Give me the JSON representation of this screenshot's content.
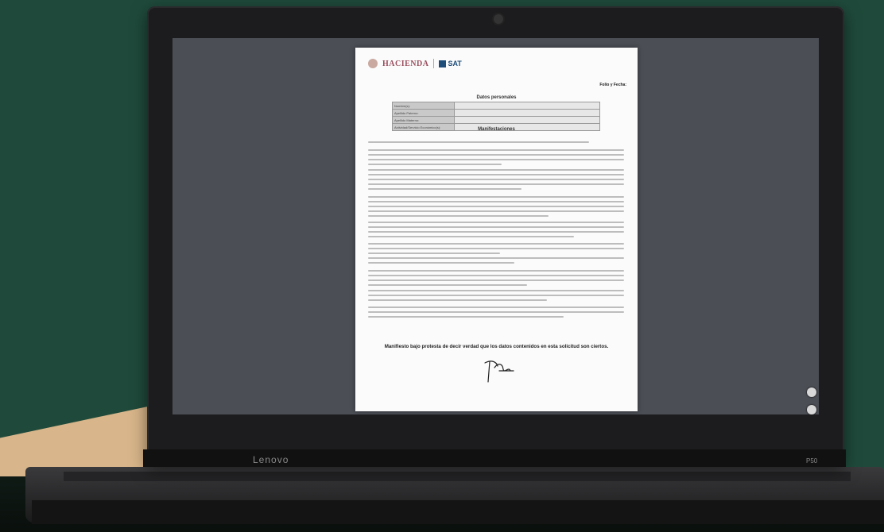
{
  "document": {
    "logo_hacienda": "HACIENDA",
    "logo_sat": "SAT",
    "folio_label": "Folio y Fecha:",
    "section_personal": "Datos personales",
    "table_rows": [
      {
        "k": "Nombre(s):",
        "v": ""
      },
      {
        "k": "Apellido Paterno:",
        "v": ""
      },
      {
        "k": "Apellido Materno:",
        "v": ""
      },
      {
        "k": "Actividad/Servicio Económico(s):",
        "v": ""
      }
    ],
    "section_manifest": "Manifestaciones",
    "declaration": "Manifiesto bajo protesta de decir verdad que los datos contenidos en esta solicitud son ciertos."
  },
  "laptop": {
    "brand": "Lenovo",
    "model": "P50"
  },
  "colors": {
    "background": "#1f4a3b",
    "accent_tan": "#d8b58a",
    "screen_gray": "#4b4e55",
    "hacienda_maroon": "#9a4e5e",
    "sat_blue": "#1f4d7a"
  }
}
